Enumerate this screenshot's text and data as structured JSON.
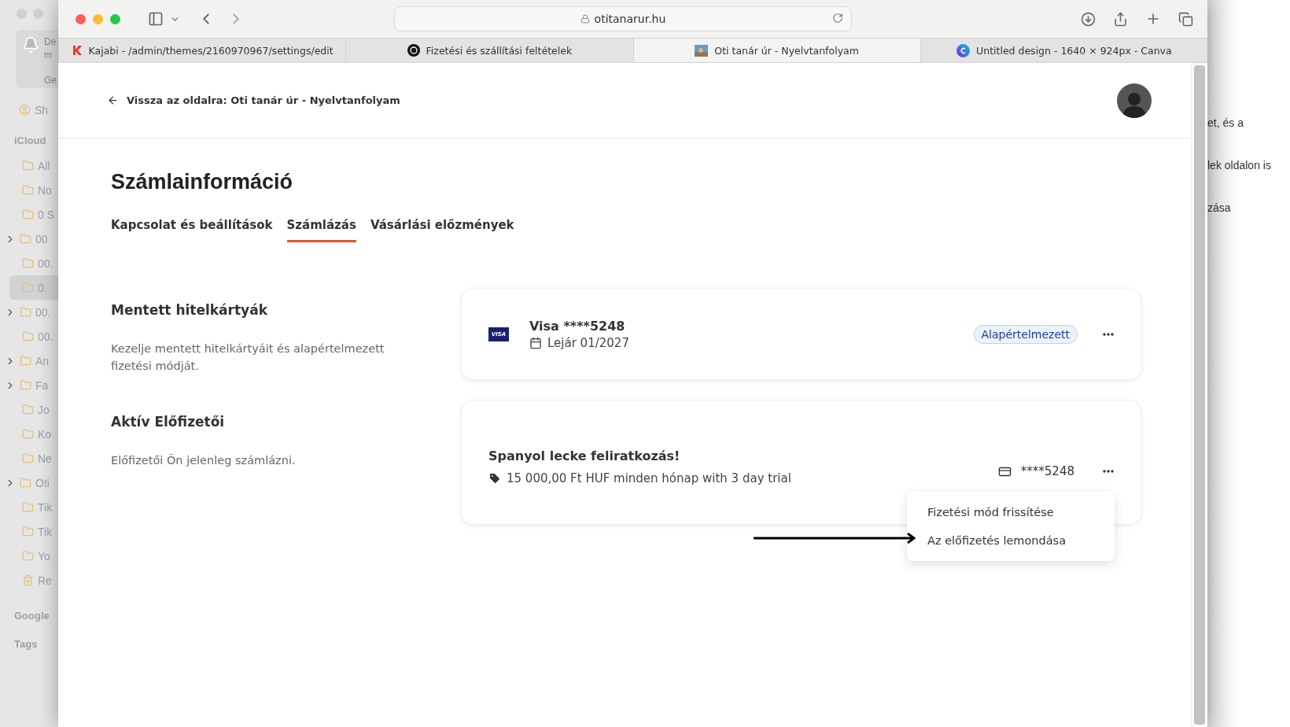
{
  "background_sidebar": {
    "notification": {
      "title": "De",
      "subtitle": "m",
      "action": "Ge"
    },
    "shared": "Sh",
    "section": "iCloud",
    "folders": [
      {
        "label": "All",
        "expandable": false,
        "selected": false
      },
      {
        "label": "No",
        "expandable": false,
        "selected": false
      },
      {
        "label": "0 S",
        "expandable": false,
        "selected": false
      },
      {
        "label": "00",
        "expandable": true,
        "selected": false
      },
      {
        "label": "00.",
        "expandable": false,
        "selected": false
      },
      {
        "label": "0.",
        "expandable": false,
        "selected": true
      },
      {
        "label": "00.",
        "expandable": true,
        "selected": false
      },
      {
        "label": "00.",
        "expandable": false,
        "selected": false
      },
      {
        "label": "An",
        "expandable": true,
        "selected": false
      },
      {
        "label": "Fa",
        "expandable": true,
        "selected": false
      },
      {
        "label": "Jo",
        "expandable": false,
        "selected": false
      },
      {
        "label": "Ko",
        "expandable": false,
        "selected": false
      },
      {
        "label": "Ne",
        "expandable": false,
        "selected": false
      },
      {
        "label": "Oti",
        "expandable": true,
        "selected": false
      },
      {
        "label": "Tik",
        "expandable": false,
        "selected": false
      },
      {
        "label": "Tik",
        "expandable": false,
        "selected": false
      },
      {
        "label": "Yo",
        "expandable": false,
        "selected": false
      },
      {
        "label": "Re",
        "expandable": false,
        "selected": false,
        "kind": "trash"
      }
    ],
    "sections": [
      "Google",
      "Tags"
    ]
  },
  "browser": {
    "address": "otitanarur.hu",
    "tabs": [
      {
        "title": "Kajabi - /admin/themes/2160970967/settings/edit",
        "selected": false
      },
      {
        "title": "Fizetési és szállítási feltételek",
        "selected": false
      },
      {
        "title": "Oti tanár úr - Nyelvtanfolyam",
        "selected": true
      },
      {
        "title": "Untitled design - 1640 × 924px - Canva",
        "selected": false
      }
    ]
  },
  "page": {
    "back_link": "Vissza az oldalra: Oti tanár úr - Nyelvtanfolyam",
    "title": "Számlainformáció",
    "tabs": [
      {
        "label": "Kapcsolat és beállítások",
        "selected": false
      },
      {
        "label": "Számlázás",
        "selected": true
      },
      {
        "label": "Vásárlási előzmények",
        "selected": false
      }
    ],
    "sections": [
      {
        "kind": "card",
        "title": "Mentett hitelkártyák",
        "description": "Kezelje mentett hitelkártyáit és alapértelmezett fizetési módját.",
        "card": {
          "brand": "VISA",
          "name": "Visa ****5248",
          "expiry": "Lejár 01/2027",
          "badge": "Alapértelmezett"
        }
      },
      {
        "kind": "subscription",
        "title": "Aktív Előfizetői",
        "description": "Előfizetői Ön jelenleg számlázni.",
        "subscription": {
          "name": "Spanyol lecke feliratkozás!",
          "price": "15 000,00 Ft HUF minden hónap with 3 day trial",
          "card": "****5248",
          "menu": [
            {
              "label": "Fizetési mód frissítése"
            },
            {
              "label": "Az előfizetés lemondása"
            }
          ]
        }
      }
    ]
  },
  "background_text": [
    "et, és a",
    "lek oldalon is",
    "zása"
  ]
}
